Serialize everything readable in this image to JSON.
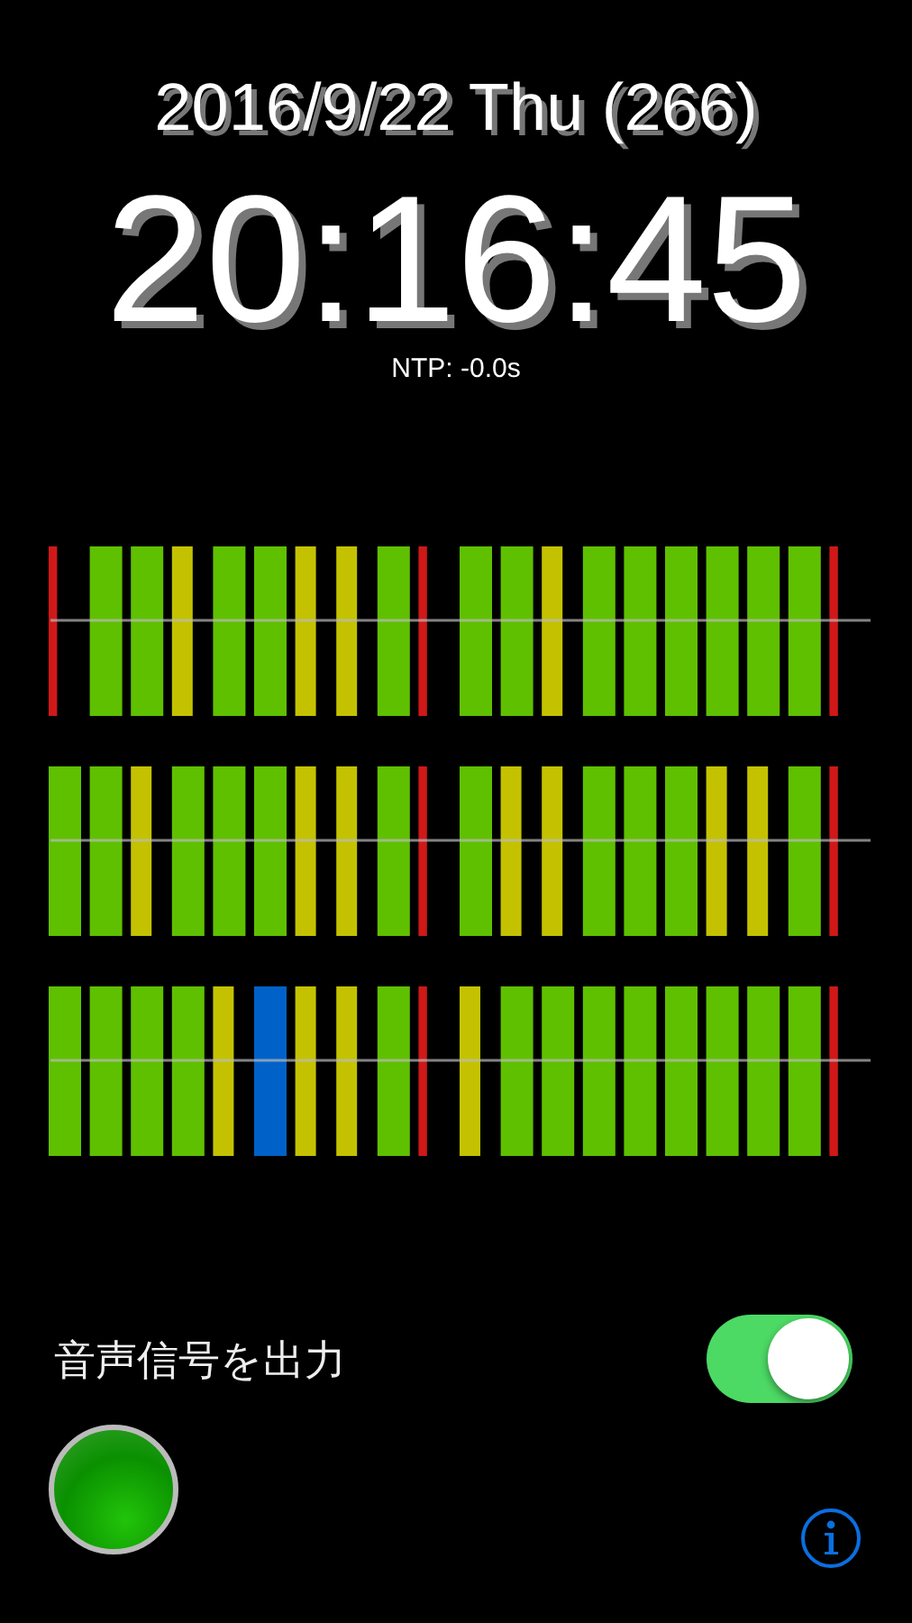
{
  "date": "2016/9/22 Thu (266)",
  "time": "20:16:45",
  "ntp": "NTP: -0.0s",
  "signal_rows": [
    {
      "bars": [
        {
          "kind": "marker",
          "current": false
        },
        {
          "kind": "zero",
          "current": false
        },
        {
          "kind": "zero",
          "current": false
        },
        {
          "kind": "one",
          "current": false
        },
        {
          "kind": "zero",
          "current": false
        },
        {
          "kind": "zero",
          "current": false
        },
        {
          "kind": "one",
          "current": false
        },
        {
          "kind": "one",
          "current": false
        },
        {
          "kind": "zero",
          "current": false
        },
        {
          "kind": "marker",
          "current": false
        },
        {
          "kind": "zero",
          "current": false
        },
        {
          "kind": "zero",
          "current": false
        },
        {
          "kind": "one",
          "current": false
        },
        {
          "kind": "zero",
          "current": false
        },
        {
          "kind": "zero",
          "current": false
        },
        {
          "kind": "zero",
          "current": false
        },
        {
          "kind": "zero",
          "current": false
        },
        {
          "kind": "zero",
          "current": false
        },
        {
          "kind": "zero",
          "current": false
        },
        {
          "kind": "marker",
          "current": false
        }
      ]
    },
    {
      "bars": [
        {
          "kind": "zero",
          "current": false
        },
        {
          "kind": "zero",
          "current": false
        },
        {
          "kind": "one",
          "current": false
        },
        {
          "kind": "zero",
          "current": false
        },
        {
          "kind": "zero",
          "current": false
        },
        {
          "kind": "zero",
          "current": false
        },
        {
          "kind": "one",
          "current": false
        },
        {
          "kind": "one",
          "current": false
        },
        {
          "kind": "zero",
          "current": false
        },
        {
          "kind": "marker",
          "current": false
        },
        {
          "kind": "zero",
          "current": false
        },
        {
          "kind": "one",
          "current": false
        },
        {
          "kind": "one",
          "current": false
        },
        {
          "kind": "zero",
          "current": false
        },
        {
          "kind": "zero",
          "current": false
        },
        {
          "kind": "zero",
          "current": false
        },
        {
          "kind": "one",
          "current": false
        },
        {
          "kind": "one",
          "current": false
        },
        {
          "kind": "zero",
          "current": false
        },
        {
          "kind": "marker",
          "current": false
        }
      ]
    },
    {
      "bars": [
        {
          "kind": "zero",
          "current": false
        },
        {
          "kind": "zero",
          "current": false
        },
        {
          "kind": "zero",
          "current": false
        },
        {
          "kind": "zero",
          "current": false
        },
        {
          "kind": "one",
          "current": false
        },
        {
          "kind": "zero",
          "current": true
        },
        {
          "kind": "one",
          "current": false
        },
        {
          "kind": "one",
          "current": false
        },
        {
          "kind": "zero",
          "current": false
        },
        {
          "kind": "marker",
          "current": false
        },
        {
          "kind": "one",
          "current": false
        },
        {
          "kind": "zero",
          "current": false
        },
        {
          "kind": "zero",
          "current": false
        },
        {
          "kind": "zero",
          "current": false
        },
        {
          "kind": "zero",
          "current": false
        },
        {
          "kind": "zero",
          "current": false
        },
        {
          "kind": "zero",
          "current": false
        },
        {
          "kind": "zero",
          "current": false
        },
        {
          "kind": "zero",
          "current": false
        },
        {
          "kind": "marker",
          "current": false
        }
      ]
    }
  ],
  "audio_output": {
    "label": "音声信号を出力",
    "on": true
  },
  "status_lamp": {
    "on": true
  }
}
